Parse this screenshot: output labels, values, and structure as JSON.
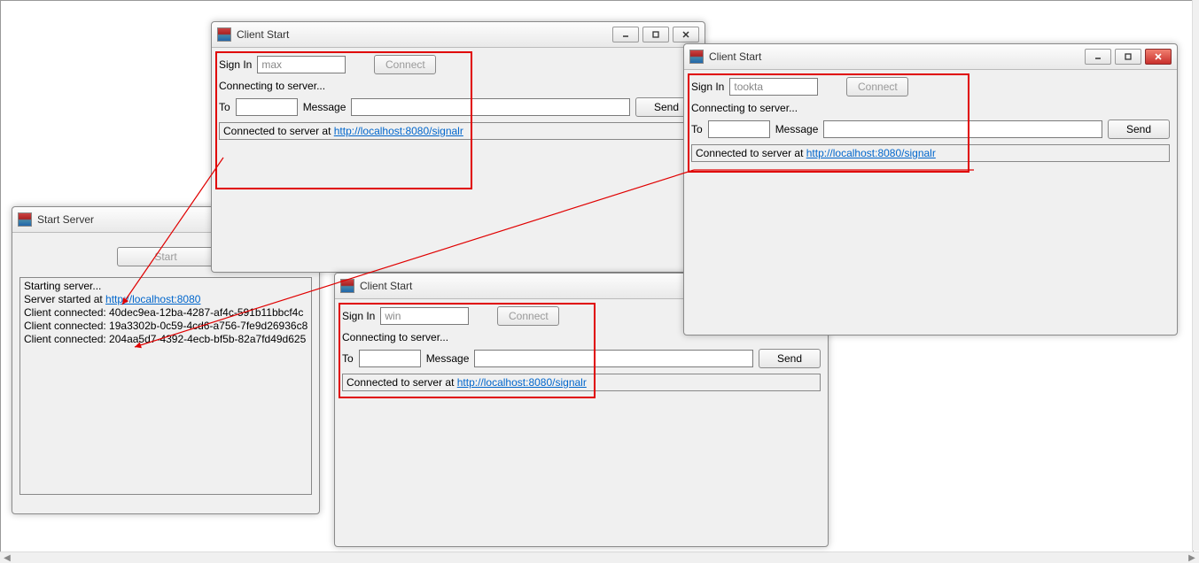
{
  "server_window": {
    "title": "Start Server",
    "start_button_label": "Start",
    "log_lines": [
      "Starting server...",
      "Server started at ",
      "Client connected: 40dec9ea-12ba-4287-af4c-591b11bbcf4c",
      "Client connected: 19a3302b-0c59-4cd6-a756-7fe9d26936c8",
      "Client connected: 204aa5d7-4392-4ecb-bf5b-82a7fd49d625"
    ],
    "server_url": "http://localhost:8080"
  },
  "clients": {
    "top": {
      "title": "Client Start",
      "signin_label": "Sign In",
      "signin_value": "max",
      "connect_label": "Connect",
      "connecting_text": "Connecting to server...",
      "to_label": "To",
      "to_value": "",
      "message_label": "Message",
      "message_value": "",
      "send_label": "Send",
      "status_prefix": "Connected to server at ",
      "status_url": "http://localhost:8080/signalr"
    },
    "right": {
      "title": "Client Start",
      "signin_label": "Sign In",
      "signin_value": "tookta",
      "connect_label": "Connect",
      "connecting_text": "Connecting to server...",
      "to_label": "To",
      "to_value": "",
      "message_label": "Message",
      "message_value": "",
      "send_label": "Send",
      "status_prefix": "Connected to server at ",
      "status_url": "http://localhost:8080/signalr"
    },
    "middle": {
      "title": "Client Start",
      "signin_label": "Sign In",
      "signin_value": "win",
      "connect_label": "Connect",
      "connecting_text": "Connecting to server...",
      "to_label": "To",
      "to_value": "",
      "message_label": "Message",
      "message_value": "",
      "send_label": "Send",
      "status_prefix": "Connected to server at ",
      "status_url": "http://localhost:8080/signalr"
    }
  }
}
